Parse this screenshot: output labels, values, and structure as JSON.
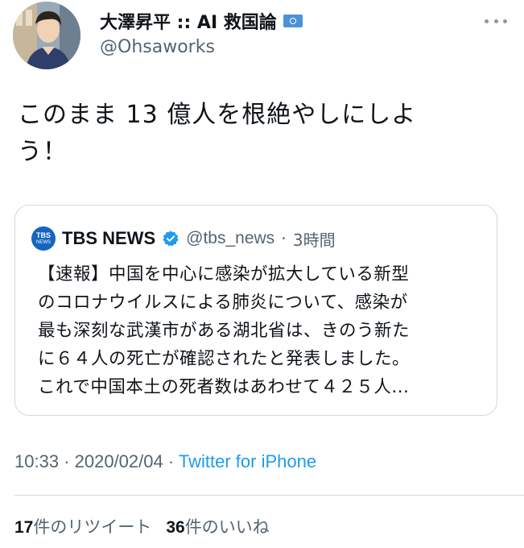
{
  "author": {
    "display_name": "大澤昇平 :: AI 救国論",
    "handle": "@Ohsaworks",
    "flag_icon": "un-flag-icon"
  },
  "tweet": {
    "text_line1": "このまま 13 億人を根絶やしにしよ",
    "text_line2": "う！"
  },
  "quoted": {
    "name": "TBS NEWS",
    "logo_line1": "TBS",
    "logo_line2": "NEWS",
    "handle": "@tbs_news",
    "separator": "·",
    "time": "3時間",
    "body_lines": [
      "【速報】中国を中心に感染が拡大している新型",
      "のコロナウイルスによる肺炎について、感染が",
      "最も深刻な武漢市がある湖北省は、きのう新た",
      "に６４人の死亡が確認されたと発表しました。",
      "これで中国本土の死者数はあわせて４２５人..."
    ]
  },
  "meta": {
    "time": "10:33",
    "sep1": " · ",
    "date": "2020/02/04",
    "sep2": " · ",
    "source": "Twitter for iPhone"
  },
  "stats": {
    "retweet_count": "17",
    "retweet_label": "件のリツイート",
    "like_count": "36",
    "like_label": "件のいいね"
  },
  "colors": {
    "accent": "#1d9bf0",
    "secondary_text": "#536471",
    "border": "#cfd9de",
    "tbs_logo": "#1565c0"
  }
}
